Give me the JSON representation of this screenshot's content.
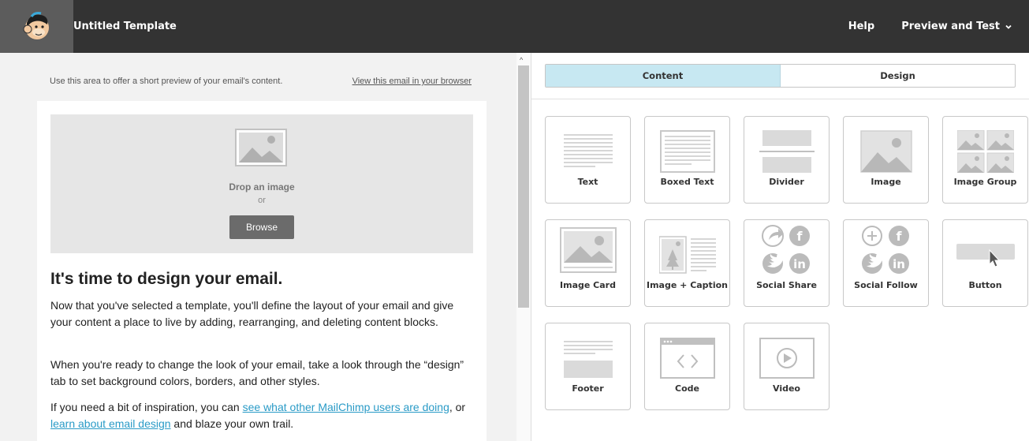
{
  "header": {
    "app_title": "Untitled Template",
    "help_label": "Help",
    "preview_label": "Preview and Test"
  },
  "preheader": {
    "preview_text": "Use this area to offer a short preview of your email's content.",
    "browser_link": "View this email in your browser"
  },
  "image_drop": {
    "title": "Drop an image",
    "or_text": "or",
    "browse_label": "Browse"
  },
  "body": {
    "headline": "It's time to design your email.",
    "p1": "Now that you've selected a template, you'll define the layout of your email and give your content a place to live by adding, rearranging, and deleting content blocks.",
    "p2": "When you're ready to change the look of your email, take a look through the “design” tab to set background colors, borders, and other styles.",
    "p3_pre": "If you need a bit of inspiration, you can ",
    "p3_link1": "see what other MailChimp users are doing",
    "p3_mid": ", or ",
    "p3_link2": "learn about email design",
    "p3_post": " and blaze your own trail."
  },
  "tabs": {
    "content": "Content",
    "design": "Design",
    "active": "Content"
  },
  "blocks": [
    {
      "label": "Text",
      "icon": "text-icon"
    },
    {
      "label": "Boxed Text",
      "icon": "boxed-text-icon"
    },
    {
      "label": "Divider",
      "icon": "divider-icon"
    },
    {
      "label": "Image",
      "icon": "image-icon"
    },
    {
      "label": "Image Group",
      "icon": "image-group-icon"
    },
    {
      "label": "Image Card",
      "icon": "image-card-icon"
    },
    {
      "label": "Image + Caption",
      "icon": "image-caption-icon"
    },
    {
      "label": "Social Share",
      "icon": "social-share-icon"
    },
    {
      "label": "Social Follow",
      "icon": "social-follow-icon"
    },
    {
      "label": "Button",
      "icon": "button-icon"
    },
    {
      "label": "Footer",
      "icon": "footer-icon"
    },
    {
      "label": "Code",
      "icon": "code-icon"
    },
    {
      "label": "Video",
      "icon": "video-icon"
    }
  ],
  "colors": {
    "topbar": "#333333",
    "active_tab": "#c7e8f2",
    "link": "#2a9bc7",
    "icon_gray": "#c8c8c8"
  }
}
